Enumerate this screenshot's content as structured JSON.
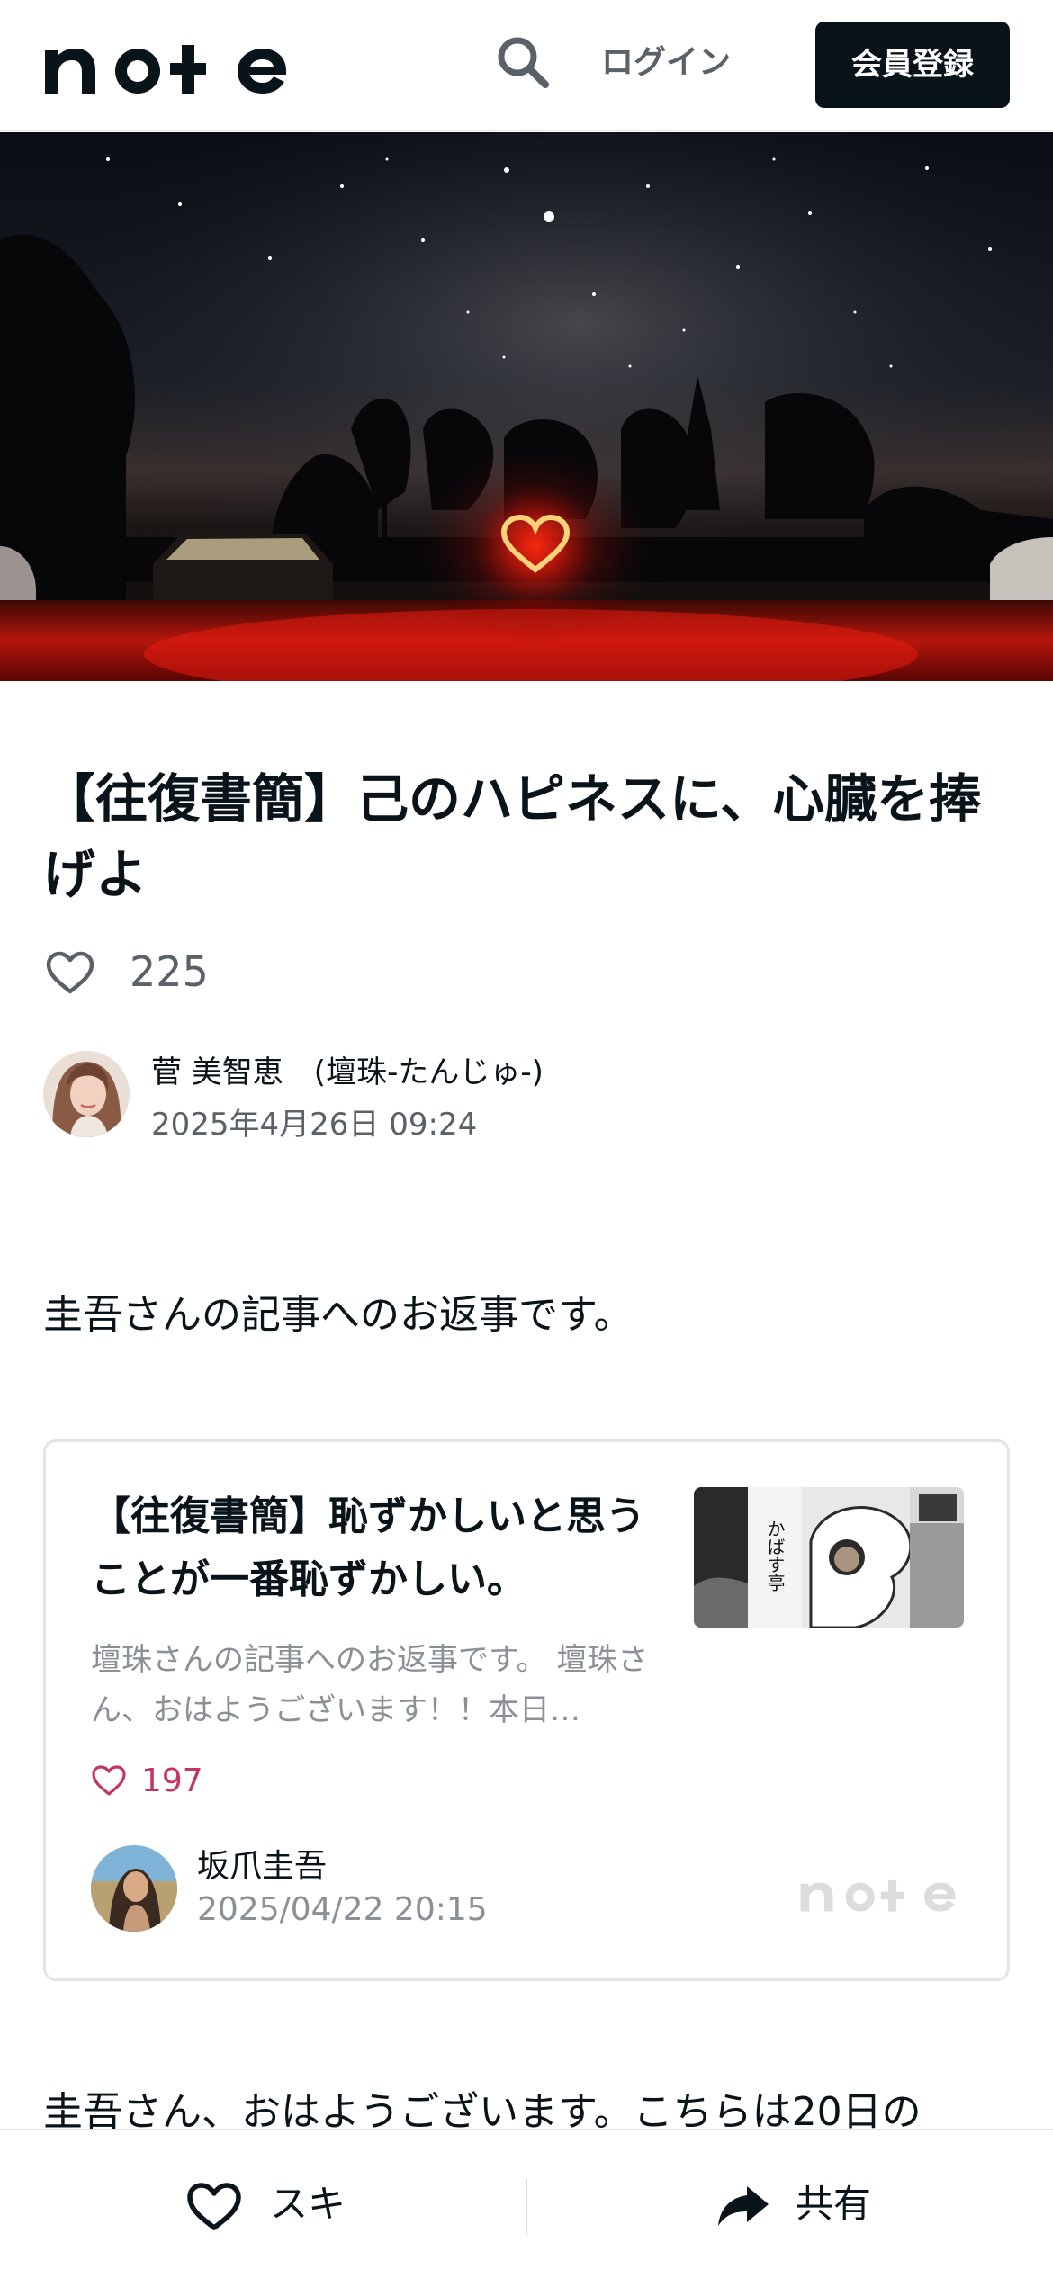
{
  "header": {
    "logo_text": "note",
    "search_icon": "search-icon",
    "login_label": "ログイン",
    "signup_label": "会員登録"
  },
  "hero": {
    "icon": "heart-light-icon"
  },
  "article": {
    "title": "【往復書簡】己のハピネスに、心臓を捧げよ",
    "like_count": "225",
    "author_name": "菅 美智恵　(壇珠-たんじゅ-)",
    "published_at": "2025年4月26日 09:24",
    "intro": "圭吾さんの記事へのお返事です。",
    "next_paragraph": "圭吾さん、おはようございます。こちらは20日の"
  },
  "embed_card": {
    "title": "【往復書簡】恥ずかしいと思うことが一番恥ずかしい。",
    "thumbnail_text": "かばす亭",
    "excerpt": "壇珠さんの記事へのお返事です。 壇珠さん、おはようございます！！本日…",
    "like_count": "197",
    "author_name": "坂爪圭吾",
    "published_at": "2025/04/22 20:15",
    "source_logo": "note",
    "like_color": "#c6365a"
  },
  "bottom_bar": {
    "like_label": "スキ",
    "share_label": "共有",
    "like_icon": "heart-icon",
    "share_icon": "share-arrow-icon"
  }
}
